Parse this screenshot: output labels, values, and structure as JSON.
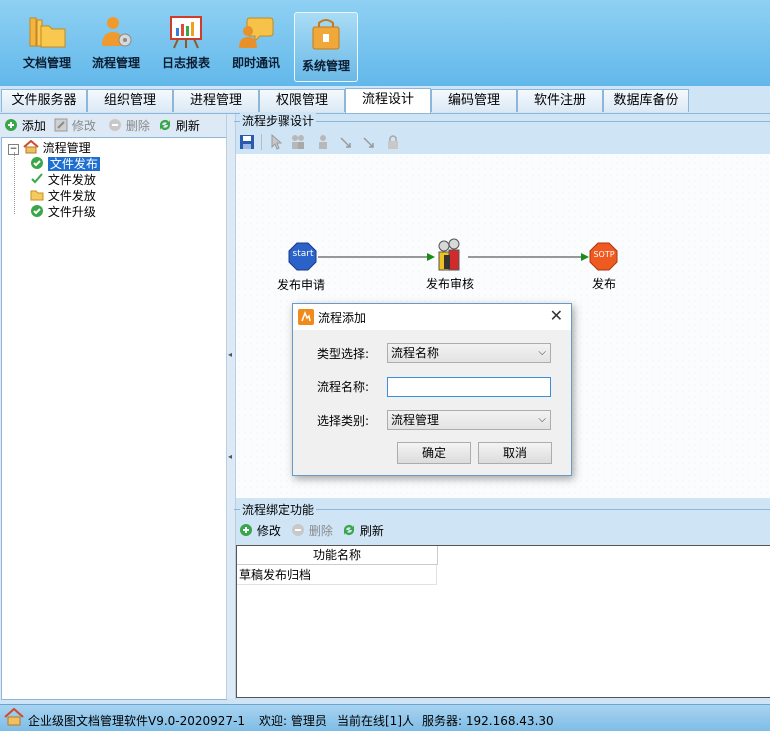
{
  "toolbar": {
    "items": [
      {
        "label": "文档管理",
        "icon": "folders-icon"
      },
      {
        "label": "流程管理",
        "icon": "user-gear-icon"
      },
      {
        "label": "日志报表",
        "icon": "chart-board-icon"
      },
      {
        "label": "即时通讯",
        "icon": "chat-user-icon"
      },
      {
        "label": "系统管理",
        "icon": "lock-box-icon",
        "active": true
      }
    ]
  },
  "tabs": [
    "文件服务器",
    "组织管理",
    "进程管理",
    "权限管理",
    "流程设计",
    "编码管理",
    "软件注册",
    "数据库备份"
  ],
  "active_tab": "流程设计",
  "left": {
    "buttons": {
      "add": "添加",
      "edit": "修改",
      "delete": "删除",
      "refresh": "刷新"
    },
    "tree": {
      "root": "流程管理",
      "children": [
        "文件发布",
        "文件发放",
        "文件发放",
        "文件升级"
      ],
      "selected": "文件发布"
    }
  },
  "design": {
    "title": "流程步骤设计",
    "nodes": {
      "start_icon": "start",
      "start": "发布申请",
      "review": "发布审核",
      "stop_icon": "SOTP",
      "end": "发布"
    }
  },
  "binding": {
    "title": "流程绑定功能",
    "buttons": {
      "edit": "修改",
      "delete": "删除",
      "refresh": "刷新"
    },
    "column": "功能名称",
    "rows": [
      "草稿发布归档"
    ]
  },
  "dialog": {
    "title": "流程添加",
    "type_label": "类型选择:",
    "type_value": "流程名称",
    "name_label": "流程名称:",
    "name_value": "",
    "category_label": "选择类别:",
    "category_value": "流程管理",
    "ok": "确定",
    "cancel": "取消"
  },
  "status": {
    "app": "企业级图文档管理软件V9.0-2020927-1",
    "welcome": "欢迎: 管理员",
    "online": "当前在线[1]人",
    "server": "服务器: 192.168.43.30"
  },
  "colors": {
    "accent": "#1f6fd1",
    "toolbar": "#62b8ea",
    "start": "#2a62c9",
    "stop": "#ee5a1f",
    "arrow": "#1a8a1a"
  }
}
